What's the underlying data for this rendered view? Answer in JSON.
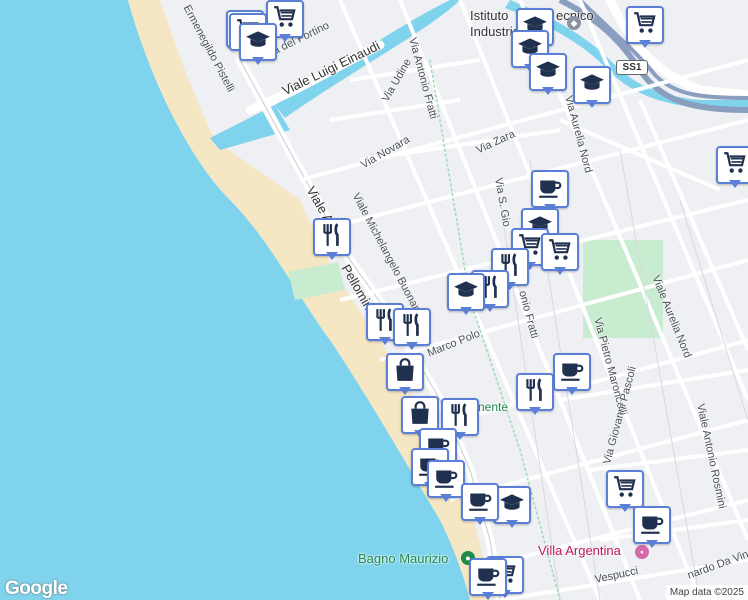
{
  "map": {
    "labels": {
      "viale_einaudi": "Viale Luigi Einaudi",
      "via_fortino": "Via del Fortino",
      "ermenegildo": "Ermenegildo Pistelli",
      "via_udine": "Via Udine",
      "via_fratti": "Via Antonio Fratti",
      "via_novara": "Via Novara",
      "via_zara": "Via Zara",
      "via_buonarroti": "Viale Michelangelo Buonarroti",
      "viale_a": "Viale A",
      "mazzini_part": "Pellomini",
      "via_s_gio": "Via S. Gio",
      "fratti_part": "onio Fratti",
      "aurelia_nord_1": "Via Aurelia Nord",
      "aurelia_nord_2": "Viale Aurelia Nord",
      "via_maroncelli": "Via Pietro Maroncelli",
      "via_pascoli": "Via Giovanni Pascoli",
      "via_rosmini": "Viale Antonio Rosmini",
      "marco_polo": "Marco Polo",
      "istituto": "Istituto",
      "industriale": "Industriale",
      "ss1": "SS1",
      "bagno_maurizio": "Bagno Maurizio",
      "villa_argentina": "Villa Argentina",
      "nente": "nente",
      "vespucci": "Vespucci",
      "leonardo": "nardo Da Vin",
      "t_letter": "T",
      "tecnico": "ecnico"
    },
    "google": "Google",
    "attribution": "Map data ©2025",
    "markers": [
      {
        "icon": "school-icon"
      },
      {
        "icon": "cart-icon"
      },
      {
        "icon": "cart-icon"
      },
      {
        "icon": "school-icon"
      },
      {
        "icon": "school-icon"
      },
      {
        "icon": "school-icon"
      },
      {
        "icon": "school-icon"
      },
      {
        "icon": "cart-icon"
      },
      {
        "icon": "school-icon"
      },
      {
        "icon": "cart-icon"
      },
      {
        "icon": "coffee-icon"
      },
      {
        "icon": "restaurant-icon"
      },
      {
        "icon": "school-icon"
      },
      {
        "icon": "cart-icon"
      },
      {
        "icon": "cart-icon"
      },
      {
        "icon": "restaurant-icon"
      },
      {
        "icon": "restaurant-icon"
      },
      {
        "icon": "school-icon"
      },
      {
        "icon": "restaurant-icon"
      },
      {
        "icon": "restaurant-icon"
      },
      {
        "icon": "shopping-bag-icon"
      },
      {
        "icon": "coffee-icon"
      },
      {
        "icon": "restaurant-icon"
      },
      {
        "icon": "shopping-bag-icon"
      },
      {
        "icon": "restaurant-icon"
      },
      {
        "icon": "coffee-icon"
      },
      {
        "icon": "coffee-icon"
      },
      {
        "icon": "coffee-icon"
      },
      {
        "icon": "school-icon"
      },
      {
        "icon": "cart-icon"
      },
      {
        "icon": "coffee-icon"
      },
      {
        "icon": "coffee-icon"
      },
      {
        "icon": "cart-icon"
      },
      {
        "icon": "coffee-icon"
      }
    ]
  }
}
